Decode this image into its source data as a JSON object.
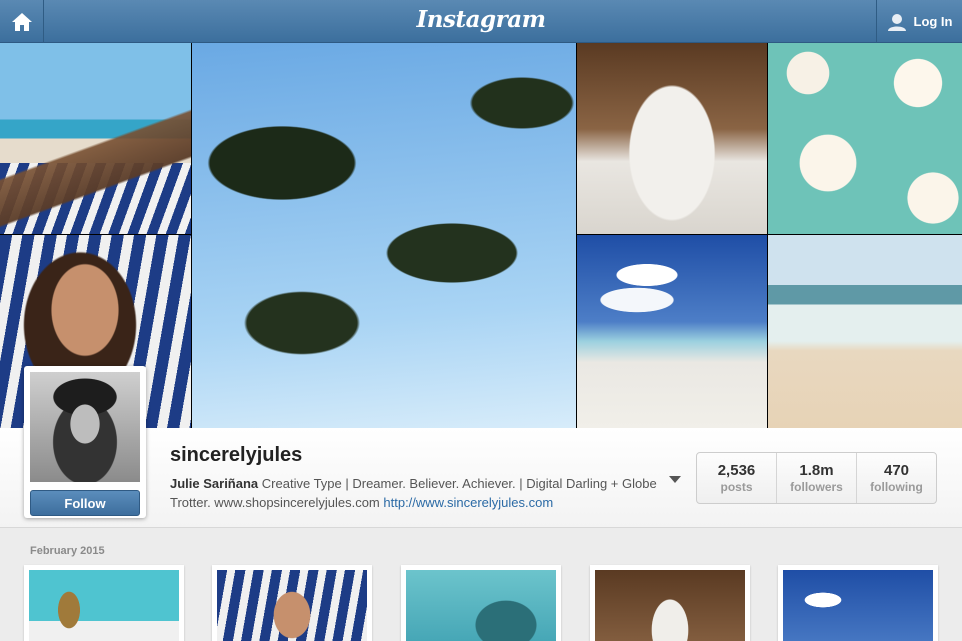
{
  "header": {
    "logo_text": "Instagram",
    "login_label": "Log In",
    "home_icon": "home-icon",
    "user_icon": "user-icon"
  },
  "profile": {
    "username": "sincerelyjules",
    "full_name": "Julie Sariñana",
    "bio": "Creative Type | Dreamer. Believer. Achiever. | Digital Darling + Globe Trotter. www.shopsincerelyjules.com",
    "website": "http://www.sincerelyjules.com",
    "follow_label": "Follow",
    "stats": [
      {
        "value": "2,536",
        "label": "posts"
      },
      {
        "value": "1.8m",
        "label": "followers"
      },
      {
        "value": "470",
        "label": "following"
      }
    ]
  },
  "feed": {
    "section_date": "February 2015"
  },
  "colors": {
    "header_blue": "#3c6f9d",
    "link_blue": "#2b6aa5"
  }
}
